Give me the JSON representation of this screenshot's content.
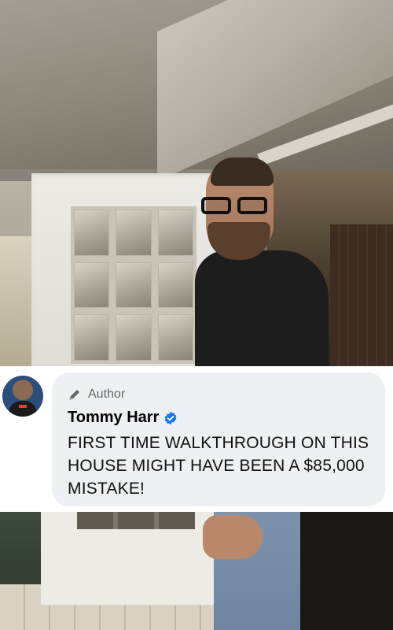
{
  "comment": {
    "author_badge": "Author",
    "author_name": "Tommy Harr",
    "verified": true,
    "text": "FIRST TIME WALKTHROUGH ON THIS HOUSE MIGHT HAVE BEEN A $85,000 MISTAKE!"
  },
  "colors": {
    "overlay_background": "#ffffff",
    "bubble_background": "#eff0f3",
    "verified_blue": "#1877f2",
    "badge_gray": "#65676b"
  },
  "icons": {
    "author_badge": "pen-icon",
    "verified": "verified-badge-icon"
  }
}
